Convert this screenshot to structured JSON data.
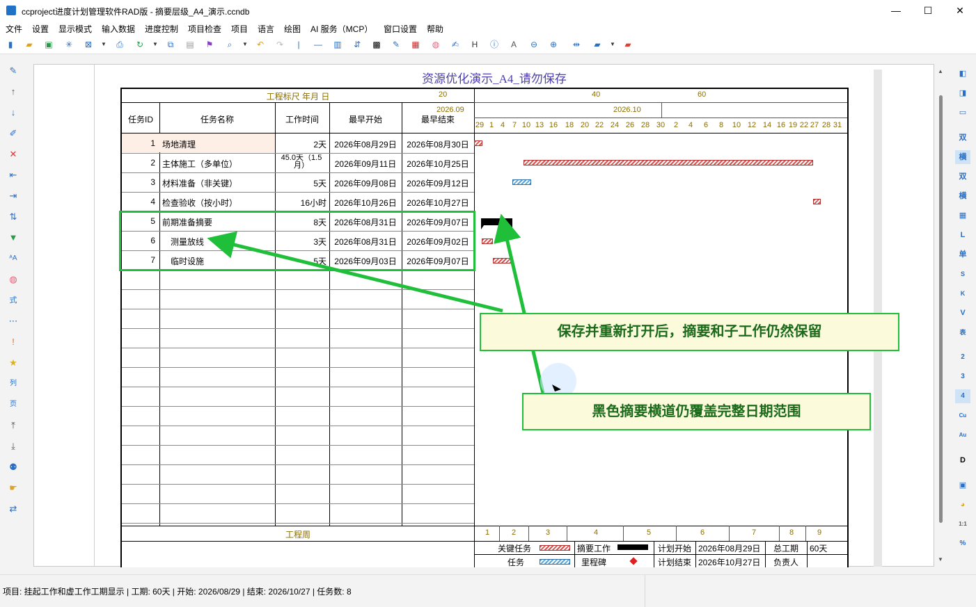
{
  "window": {
    "title": "ccproject进度计划管理软件RAD版 - 摘要层级_A4_演示.ccndb",
    "min": "—",
    "max": "☐",
    "close": "✕"
  },
  "menu": [
    "文件",
    "设置",
    "显示模式",
    "输入数据",
    "进度控制",
    "项目检查",
    "项目",
    "语言",
    "绘图",
    "AI 服务（MCP）",
    "窗口设置",
    "帮助"
  ],
  "sheet_title": "资源优化演示_A4_请勿保存",
  "table": {
    "scale_label": "工程标尺 年月 日",
    "headers": [
      "任务ID",
      "任务名称",
      "工作时间",
      "最早开始",
      "最早结束"
    ],
    "rows": [
      {
        "id": "1",
        "name": "场地清理",
        "dur": "2天",
        "start": "2026年08月29日",
        "end": "2026年08月30日"
      },
      {
        "id": "2",
        "name": "主体施工（多单位）",
        "dur": "45.0天（1.5月）",
        "start": "2026年09月11日",
        "end": "2026年10月25日"
      },
      {
        "id": "3",
        "name": "材料准备（非关键）",
        "dur": "5天",
        "start": "2026年09月08日",
        "end": "2026年09月12日"
      },
      {
        "id": "4",
        "name": "检查验收（按小时）",
        "dur": "16小时",
        "start": "2026年10月26日",
        "end": "2026年10月27日"
      },
      {
        "id": "5",
        "name": "前期准备摘要",
        "dur": "8天",
        "start": "2026年08月31日",
        "end": "2026年09月07日"
      },
      {
        "id": "6",
        "name": "测量放线",
        "dur": "3天",
        "start": "2026年08月31日",
        "end": "2026年09月02日"
      },
      {
        "id": "7",
        "name": "临时设施",
        "dur": "5天",
        "start": "2026年09月03日",
        "end": "2026年09月07日"
      }
    ],
    "week_label": "工程周"
  },
  "timescale": {
    "ticks": [
      "20",
      "40",
      "60"
    ],
    "months": [
      "2026.09",
      "2026.10"
    ],
    "days": [
      "29",
      "1",
      "4",
      "7",
      "10",
      "13",
      "16",
      "18",
      "20",
      "22",
      "24",
      "26",
      "28",
      "30",
      "2",
      "4",
      "6",
      "8",
      "10",
      "12",
      "14",
      "16",
      "19",
      "22",
      "27",
      "28",
      "31"
    ],
    "weeks": [
      "1",
      "2",
      "3",
      "4",
      "5",
      "6",
      "7",
      "8",
      "9"
    ]
  },
  "legend": {
    "critical": "关键任务",
    "summary": "摘要工作",
    "plan_start_label": "计划开始",
    "plan_start": "2026年08月29日",
    "total_label": "总工期",
    "total": "60天",
    "task": "任务",
    "milestone": "里程碑",
    "plan_end_label": "计划结束",
    "plan_end": "2026年10月27日",
    "owner_label": "负责人"
  },
  "callouts": {
    "one": "保存并重新打开后，摘要和子工作仍然保留",
    "two": "黑色摘要横道仍覆盖完整日期范围"
  },
  "status": "项目: 挂起工作和虚工作工期显示 | 工期: 60天 | 开始: 2026/08/29 | 结束: 2026/10/27 | 任务数: 8",
  "colors": {
    "accent": "#1fbf3a",
    "title": "#4b3fb0",
    "critical": "#d9534f",
    "normal": "#5aa6d6"
  }
}
